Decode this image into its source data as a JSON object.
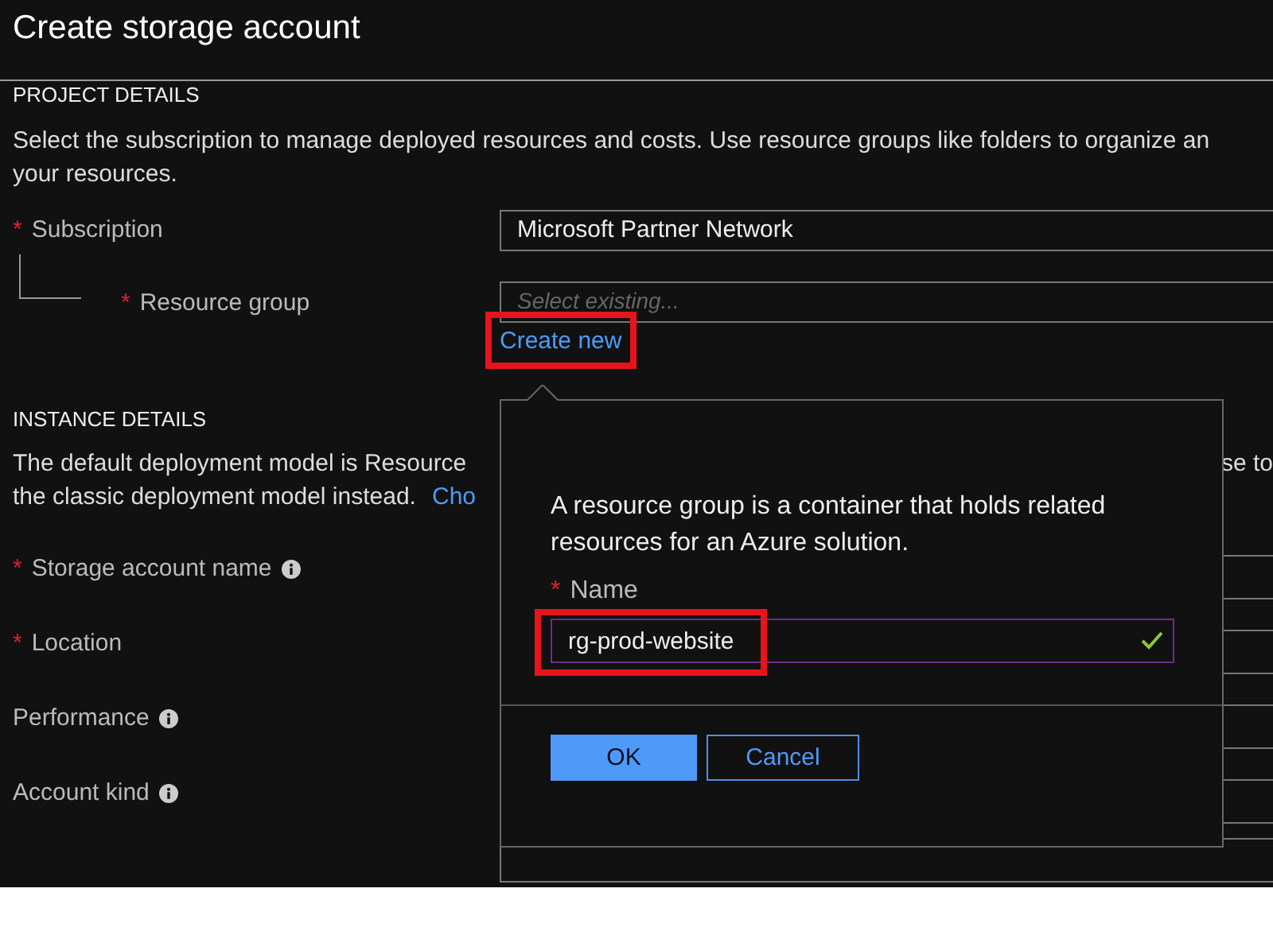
{
  "window": {
    "title": "Create storage account"
  },
  "project_details": {
    "heading": "PROJECT DETAILS",
    "description_line_1": "Select the subscription to manage deployed resources and costs. Use resource groups like folders to organize an",
    "description_line_2": "your resources.",
    "subscription": {
      "label": "Subscription",
      "required_marker": "*",
      "value": "Microsoft Partner Network"
    },
    "resource_group": {
      "label": "Resource group",
      "required_marker": "*",
      "placeholder": "Select existing...",
      "create_link": {
        "label": "Create new",
        "highlighted": true
      }
    }
  },
  "instance_details": {
    "heading": "INSTANCE DETAILS",
    "line_1_left": "The default deployment model is Resource",
    "line_1_right": "se to",
    "line_2": "the classic deployment model instead.",
    "link": "Cho",
    "fields": [
      {
        "label": "Storage account name",
        "required_marker": "*",
        "info": true
      },
      {
        "label": "Location",
        "required_marker": "*",
        "info": false
      },
      {
        "label": "Performance",
        "info": true
      },
      {
        "label": "Account kind",
        "info": true
      }
    ]
  },
  "popup": {
    "description": "A resource group is a container that holds related resources for an Azure solution.",
    "name_label": "Name",
    "name_required_marker": "*",
    "name_value": "rg-prod-website",
    "valid": true,
    "value_highlighted": true,
    "buttons": [
      {
        "label": "OK",
        "kind": "primary"
      },
      {
        "label": "Cancel",
        "kind": "secondary"
      }
    ]
  }
}
